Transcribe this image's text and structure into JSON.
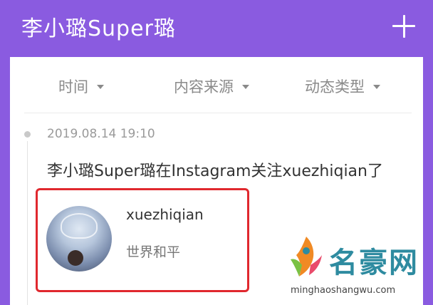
{
  "header": {
    "title": "李小璐Super璐",
    "add_icon": "plus-icon"
  },
  "filters": [
    {
      "label": "时间"
    },
    {
      "label": "内容来源"
    },
    {
      "label": "动态类型"
    }
  ],
  "post": {
    "timestamp": "2019.08.14 19:10",
    "text": "李小璐Super璐在Instagram关注xuezhiqian了",
    "user": {
      "username": "xuezhiqian",
      "bio": "世界和平"
    }
  },
  "watermark": {
    "title": "名豪网",
    "url": "minghaoshangwu.com"
  },
  "colors": {
    "header_bg": "#8a5be0",
    "highlight_border": "#e0282e",
    "watermark_text": "#2e8ba0"
  }
}
